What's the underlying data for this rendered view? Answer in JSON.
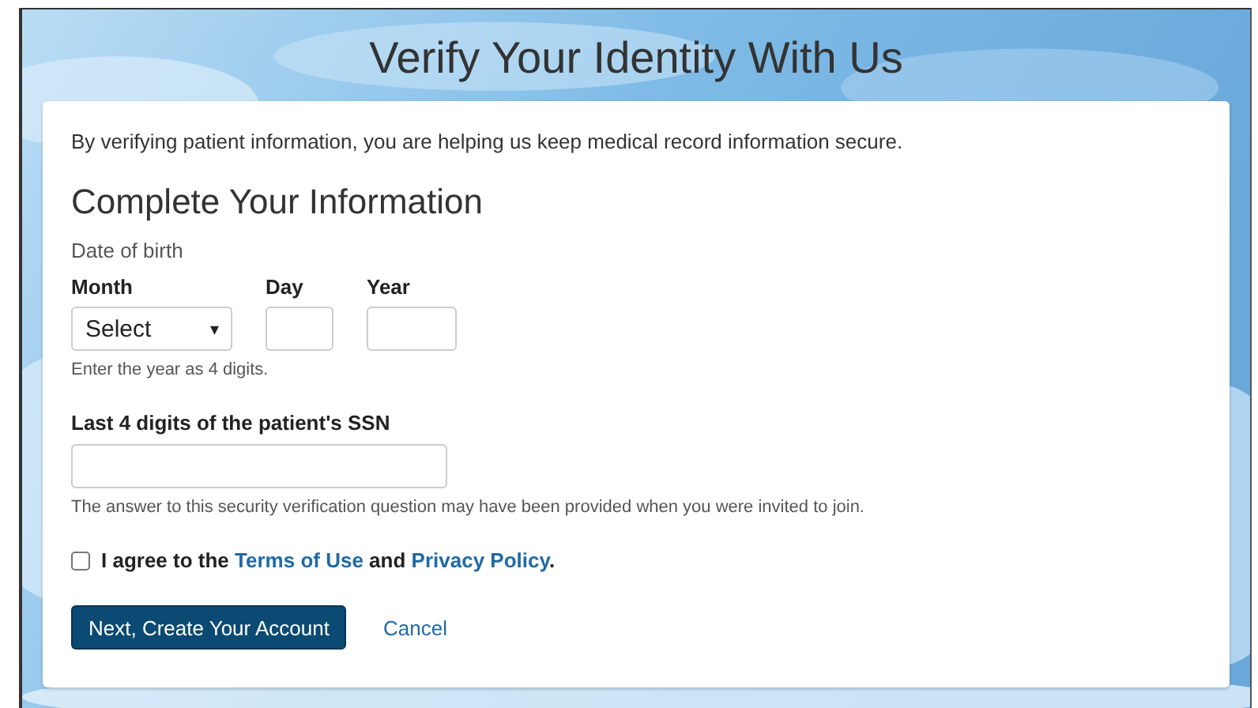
{
  "title": "Verify Your Identity With Us",
  "intro": "By verifying patient information, you are helping us keep medical record information  secure.",
  "heading": "Complete Your Information",
  "dob": {
    "label": "Date of birth",
    "month": {
      "label": "Month",
      "value": "Select",
      "caret": "▾"
    },
    "day": {
      "label": "Day"
    },
    "year": {
      "label": "Year"
    },
    "hint": "Enter the year as 4 digits."
  },
  "ssn": {
    "label": "Last 4 digits of the patient's SSN",
    "hint": "The answer to this security verification question may have been provided when you were invited to join."
  },
  "agreement": {
    "checked": false,
    "parts": [
      {
        "kind": "text",
        "text": "I agree to the "
      },
      {
        "kind": "link",
        "text": "Terms of Use"
      },
      {
        "kind": "text",
        "text": " and "
      },
      {
        "kind": "link",
        "text": "Privacy Policy"
      },
      {
        "kind": "text",
        "text": "."
      }
    ]
  },
  "buttons": {
    "submit": "Next, Create Your Account",
    "cancel": "Cancel"
  }
}
